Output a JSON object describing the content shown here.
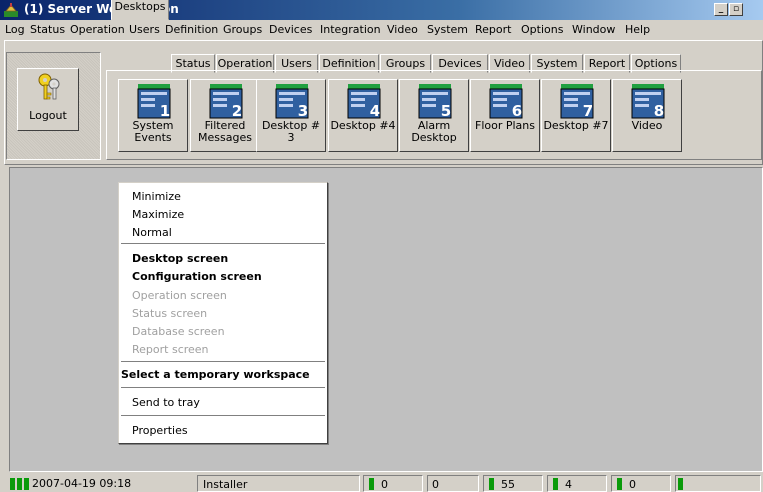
{
  "window": {
    "title": "(1)  Server Workstation",
    "minimize_glyph": "_",
    "restore_glyph": "▫"
  },
  "menubar": {
    "items": [
      "Log",
      "Status",
      "Operation",
      "Users",
      "Definition",
      "Groups",
      "Devices",
      "Integration",
      "Video",
      "System",
      "Report",
      "Options",
      "Window",
      "Help"
    ]
  },
  "logout": {
    "label": "Logout",
    "icon": "keys-icon"
  },
  "tabs": {
    "items": [
      "Desktops",
      "Status",
      "Operation",
      "Users",
      "Definition",
      "Groups",
      "Devices",
      "Video",
      "System",
      "Report",
      "Options"
    ],
    "active": "Desktops"
  },
  "desktops": {
    "buttons": [
      {
        "number": "1",
        "line1": "System",
        "line2": "Events"
      },
      {
        "number": "2",
        "line1": "Filtered",
        "line2": "Messages"
      },
      {
        "number": "3",
        "line1": "Desktop # 3",
        "line2": ""
      },
      {
        "number": "4",
        "line1": "Desktop #4",
        "line2": ""
      },
      {
        "number": "5",
        "line1": "Alarm",
        "line2": "Desktop"
      },
      {
        "number": "6",
        "line1": "Floor Plans",
        "line2": ""
      },
      {
        "number": "7",
        "line1": "Desktop #7",
        "line2": ""
      },
      {
        "number": "8",
        "line1": "Video",
        "line2": ""
      }
    ]
  },
  "context_menu": {
    "minimize": "Minimize",
    "maximize": "Maximize",
    "normal": "Normal",
    "desktop_screen": "Desktop screen",
    "configuration_screen": "Configuration screen",
    "operation_screen": "Operation screen",
    "status_screen": "Status screen",
    "database_screen": "Database screen",
    "report_screen": "Report screen",
    "temp_workspace": "Select a temporary workspace",
    "send_to_tray": "Send to tray",
    "properties": "Properties"
  },
  "statusbar": {
    "datetime": "2007-04-19 09:18",
    "user": "Installer",
    "count1": "0",
    "count2": "0",
    "count3": "55",
    "count4": "4",
    "count5": "0",
    "led_color": "#0a9a0a"
  }
}
